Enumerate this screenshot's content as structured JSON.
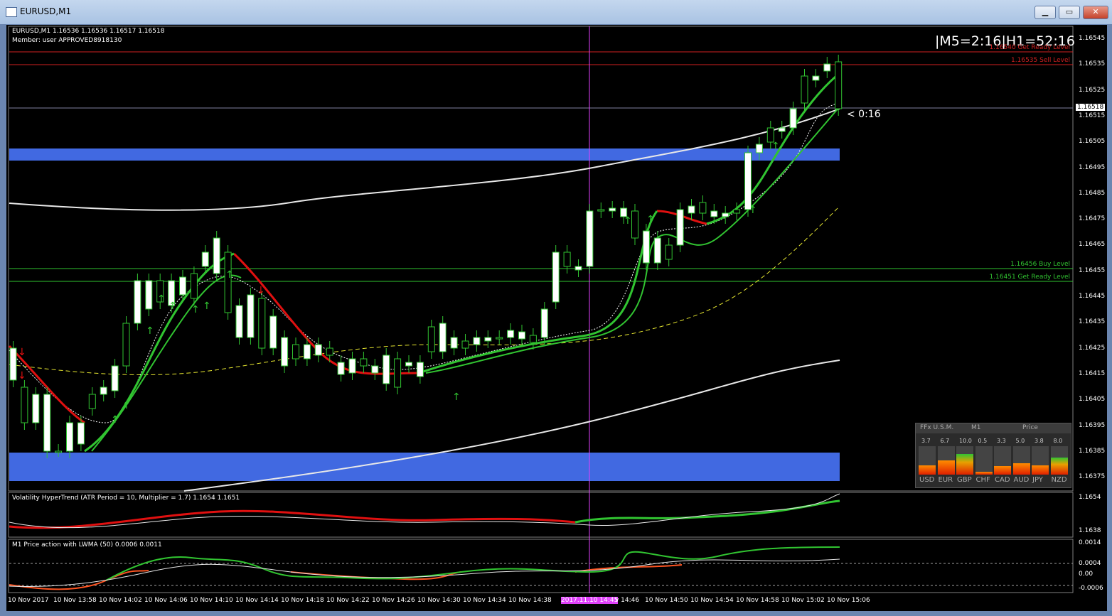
{
  "window": {
    "title": "EURUSD,M1",
    "buttons": {
      "minimize": "▁",
      "maximize": "▭",
      "close": "✕"
    }
  },
  "chart_info": {
    "symbol_line": "EURUSD,M1  1.16536 1.16536 1.16517 1.16518",
    "member_line": "Member: user   APPROVED8918130",
    "timer": "|M5=2:16|H1=52:16",
    "countdown": "< 0:16",
    "current_price": "1.16518"
  },
  "levels": [
    {
      "label": "1.16540 Get Ready Level",
      "color": "#d02020"
    },
    {
      "label": "1.16535 Sell Level",
      "color": "#d02020"
    },
    {
      "label": "1.16456 Buy Level",
      "color": "#31c431"
    },
    {
      "label": "1.16451 Get Ready Level",
      "color": "#31c431"
    }
  ],
  "price_axis": [
    "1.16545",
    "1.16535",
    "1.16525",
    "1.16515",
    "1.16505",
    "1.16495",
    "1.16485",
    "1.16475",
    "1.16465",
    "1.16455",
    "1.16445",
    "1.16435",
    "1.16425",
    "1.16415",
    "1.16405",
    "1.16395",
    "1.16385",
    "1.16375"
  ],
  "time_axis": [
    "10 Nov 2017",
    "10 Nov 13:58",
    "10 Nov 14:02",
    "10 Nov 14:06",
    "10 Nov 14:10",
    "10 Nov 14:14",
    "10 Nov 14:18",
    "10 Nov 14:22",
    "10 Nov 14:26",
    "10 Nov 14:30",
    "10 Nov 14:34",
    "10 Nov 14:38",
    "2017.11.10 14:45",
    "v 14:46",
    "10 Nov 14:50",
    "10 Nov 14:54",
    "10 Nov 14:58",
    "10 Nov 15:02",
    "10 Nov 15:06"
  ],
  "indicator1": {
    "label": "Volatility HyperTrend (ATR Period = 10, Multiplier = 1.7) 1.1654 1.1651",
    "axis": [
      "1.1654",
      "1.1638"
    ]
  },
  "indicator2": {
    "label": "M1 Price action with LWMA (50) 0.0006 0.0011",
    "axis": [
      "0.0014",
      "0.0004",
      "0.00",
      "-0.0006"
    ]
  },
  "strength_panel": {
    "header": [
      "FFx U.S.M.",
      "M1",
      "Price"
    ],
    "values": [
      "3.7",
      "6.7",
      "10.0",
      "0.5",
      "3.3",
      "5.0",
      "3.8",
      "8.0"
    ],
    "currencies": [
      "USD",
      "EUR",
      "GBP",
      "CHF",
      "CAD",
      "AUD",
      "JPY",
      "NZD"
    ],
    "bar_levels": [
      0.37,
      0.67,
      1.0,
      0.05,
      0.33,
      0.5,
      0.38,
      0.8
    ]
  },
  "colors": {
    "bull": "#ffffff",
    "up_trend": "#31c431",
    "down_trend": "#e01010",
    "zone": "#4169e1",
    "cursor": "#e040fb"
  }
}
